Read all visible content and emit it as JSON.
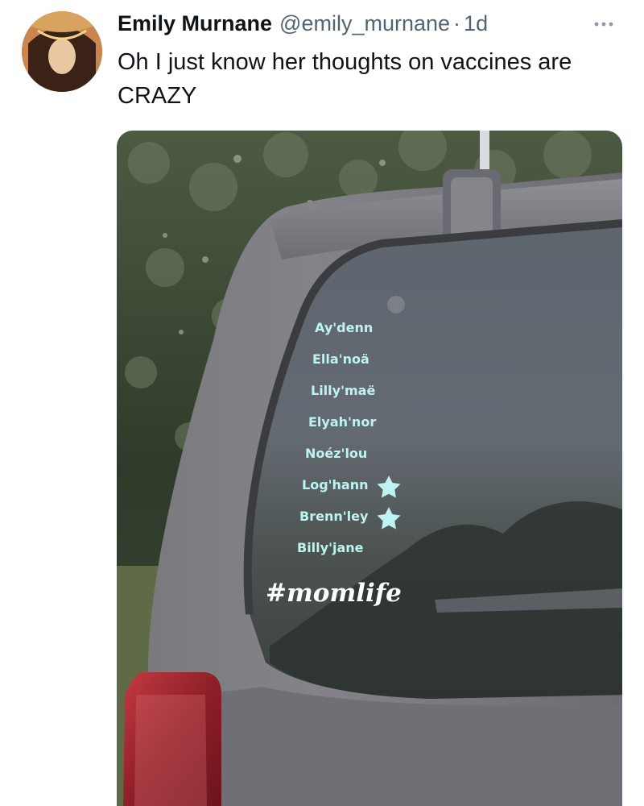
{
  "tweet": {
    "author_name": "Emily Murnane",
    "handle": "@emily_murnane",
    "separator": "·",
    "timestamp": "1d",
    "more_icon": "more-icon",
    "text": "Oh I just know her thoughts on vaccines are CRAZY"
  },
  "media": {
    "decal_names": [
      "Ay'denn",
      "Ella'noä",
      "Lilly'maë",
      "Elyah'nor",
      "Noéz'lou",
      "Log'hann",
      "Brenn'ley",
      "Billy'jane"
    ],
    "star_icon": "star-icon",
    "hashtag": "#momlife",
    "decal_color": "#bff3f2"
  }
}
